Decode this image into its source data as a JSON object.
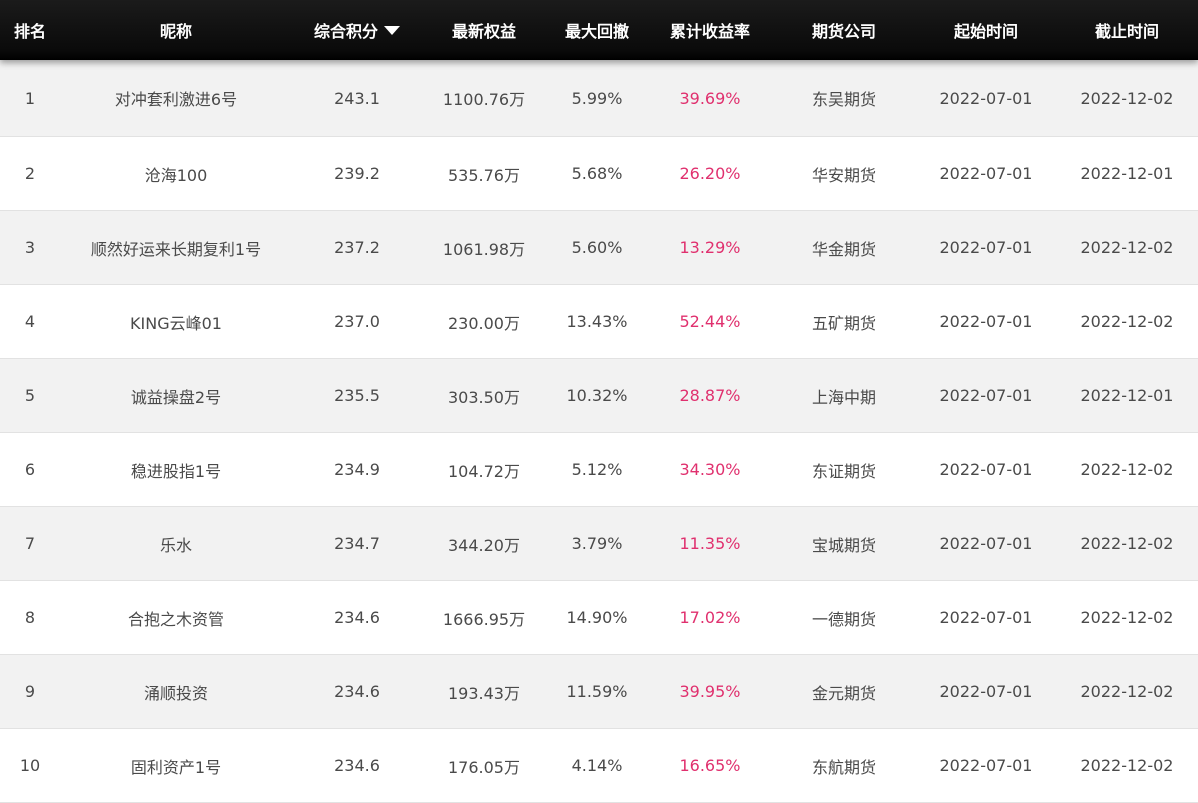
{
  "header": {
    "rank": "排名",
    "nickname": "昵称",
    "score": "综合积分",
    "equity": "最新权益",
    "drawdown": "最大回撤",
    "return": "累计收益率",
    "company": "期货公司",
    "start": "起始时间",
    "end": "截止时间",
    "sort_icon": "caret-down-icon"
  },
  "colors": {
    "header_bg": "#111111",
    "odd_row_bg": "#f2f2f2",
    "even_row_bg": "#ffffff",
    "return_text": "#e0306e",
    "body_text": "#4a4a4a"
  },
  "rows": [
    {
      "rank": "1",
      "nickname": "对冲套利激进6号",
      "score": "243.1",
      "equity": "1100.76万",
      "drawdown": "5.99%",
      "return": "39.69%",
      "company": "东吴期货",
      "start": "2022-07-01",
      "end": "2022-12-02"
    },
    {
      "rank": "2",
      "nickname": "沧海100",
      "score": "239.2",
      "equity": "535.76万",
      "drawdown": "5.68%",
      "return": "26.20%",
      "company": "华安期货",
      "start": "2022-07-01",
      "end": "2022-12-01"
    },
    {
      "rank": "3",
      "nickname": "顺然好运来长期复利1号",
      "score": "237.2",
      "equity": "1061.98万",
      "drawdown": "5.60%",
      "return": "13.29%",
      "company": "华金期货",
      "start": "2022-07-01",
      "end": "2022-12-02"
    },
    {
      "rank": "4",
      "nickname": "KING云峰01",
      "score": "237.0",
      "equity": "230.00万",
      "drawdown": "13.43%",
      "return": "52.44%",
      "company": "五矿期货",
      "start": "2022-07-01",
      "end": "2022-12-02"
    },
    {
      "rank": "5",
      "nickname": "诚益操盘2号",
      "score": "235.5",
      "equity": "303.50万",
      "drawdown": "10.32%",
      "return": "28.87%",
      "company": "上海中期",
      "start": "2022-07-01",
      "end": "2022-12-01"
    },
    {
      "rank": "6",
      "nickname": "稳进股指1号",
      "score": "234.9",
      "equity": "104.72万",
      "drawdown": "5.12%",
      "return": "34.30%",
      "company": "东证期货",
      "start": "2022-07-01",
      "end": "2022-12-02"
    },
    {
      "rank": "7",
      "nickname": "乐水",
      "score": "234.7",
      "equity": "344.20万",
      "drawdown": "3.79%",
      "return": "11.35%",
      "company": "宝城期货",
      "start": "2022-07-01",
      "end": "2022-12-02"
    },
    {
      "rank": "8",
      "nickname": "合抱之木资管",
      "score": "234.6",
      "equity": "1666.95万",
      "drawdown": "14.90%",
      "return": "17.02%",
      "company": "一德期货",
      "start": "2022-07-01",
      "end": "2022-12-02"
    },
    {
      "rank": "9",
      "nickname": "涌顺投资",
      "score": "234.6",
      "equity": "193.43万",
      "drawdown": "11.59%",
      "return": "39.95%",
      "company": "金元期货",
      "start": "2022-07-01",
      "end": "2022-12-02"
    },
    {
      "rank": "10",
      "nickname": "固利资产1号",
      "score": "234.6",
      "equity": "176.05万",
      "drawdown": "4.14%",
      "return": "16.65%",
      "company": "东航期货",
      "start": "2022-07-01",
      "end": "2022-12-02"
    }
  ]
}
